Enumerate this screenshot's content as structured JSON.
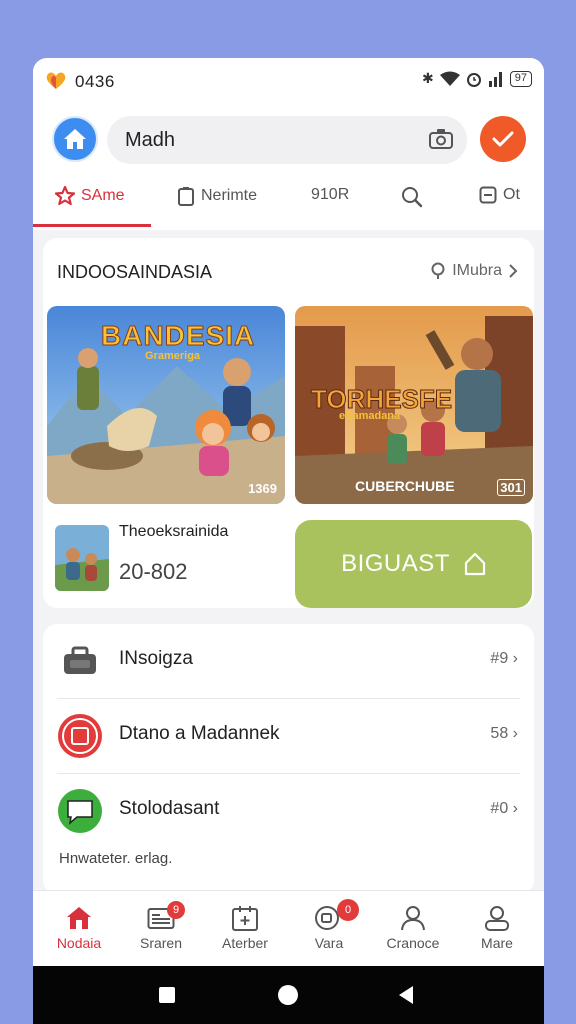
{
  "status": {
    "time": "0436",
    "battery": "97"
  },
  "search": {
    "text": "Madh"
  },
  "tabs": [
    {
      "label": "SAme",
      "icon": "star-icon"
    },
    {
      "label": "Nerimte",
      "icon": "tablet-icon"
    },
    {
      "label": "910R",
      "icon": ""
    },
    {
      "label": "",
      "icon": "search-icon"
    },
    {
      "label": "Ot",
      "icon": "box-icon"
    }
  ],
  "featured": {
    "title": "INDOOSAINDASIA",
    "more_label": "IMubra",
    "tile1": {
      "banner": "BANDESIA",
      "sub": "Grameriga",
      "tag": "1369"
    },
    "tile2": {
      "banner": "TORHESFE",
      "sub": "eSamadana",
      "caption": "CUBERCHUBE",
      "tag": "301"
    },
    "game": {
      "name": "Theoeksrainida",
      "date": "20-802"
    },
    "action_button": "BIGUAST"
  },
  "list": [
    {
      "label": "INsoigza",
      "count": "#9",
      "icon": "bag-icon"
    },
    {
      "label": "Dtano a Madannek",
      "count": "58",
      "icon": "shop-badge-icon"
    },
    {
      "label": "Stolodasant",
      "count": "#0",
      "icon": "chat-icon"
    }
  ],
  "footnote": "Hnwateter. erlag.",
  "bottom_nav": [
    {
      "label": "Nodaia",
      "icon": "home-icon",
      "badge": ""
    },
    {
      "label": "Sraren",
      "icon": "news-icon",
      "badge": "9"
    },
    {
      "label": "Aterber",
      "icon": "calendar-icon",
      "badge": ""
    },
    {
      "label": "Vara",
      "icon": "video-icon",
      "badge": "0"
    },
    {
      "label": "Cranoce",
      "icon": "person-icon",
      "badge": ""
    },
    {
      "label": "Mare",
      "icon": "profile-icon",
      "badge": ""
    }
  ],
  "colors": {
    "accent": "#d8313b",
    "orange": "#f05a28",
    "blue": "#3d8df0",
    "green_button": "#a9c25e",
    "backdrop": "#8a9be6"
  }
}
